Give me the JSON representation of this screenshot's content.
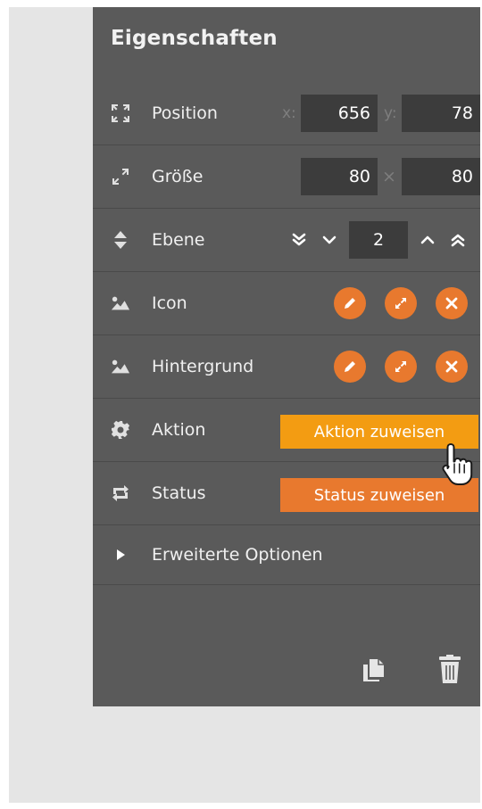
{
  "panel": {
    "title": "Eigenschaften"
  },
  "position": {
    "label": "Position",
    "x_label": "x:",
    "x_value": "656",
    "y_label": "y:",
    "y_value": "78"
  },
  "size": {
    "label": "Größe",
    "width": "80",
    "separator": "×",
    "height": "80"
  },
  "layer": {
    "label": "Ebene",
    "value": "2"
  },
  "icon_row": {
    "label": "Icon"
  },
  "background_row": {
    "label": "Hintergrund"
  },
  "action_row": {
    "label": "Aktion",
    "button": "Aktion zuweisen"
  },
  "status_row": {
    "label": "Status",
    "button": "Status zuweisen"
  },
  "advanced": {
    "label": "Erweiterte Optionen"
  },
  "colors": {
    "panel_bg": "#5a5a5a",
    "field_bg": "#3c3c3c",
    "accent": "#e8792e",
    "action_button": "#f39c12",
    "status_button": "#e8792e"
  }
}
